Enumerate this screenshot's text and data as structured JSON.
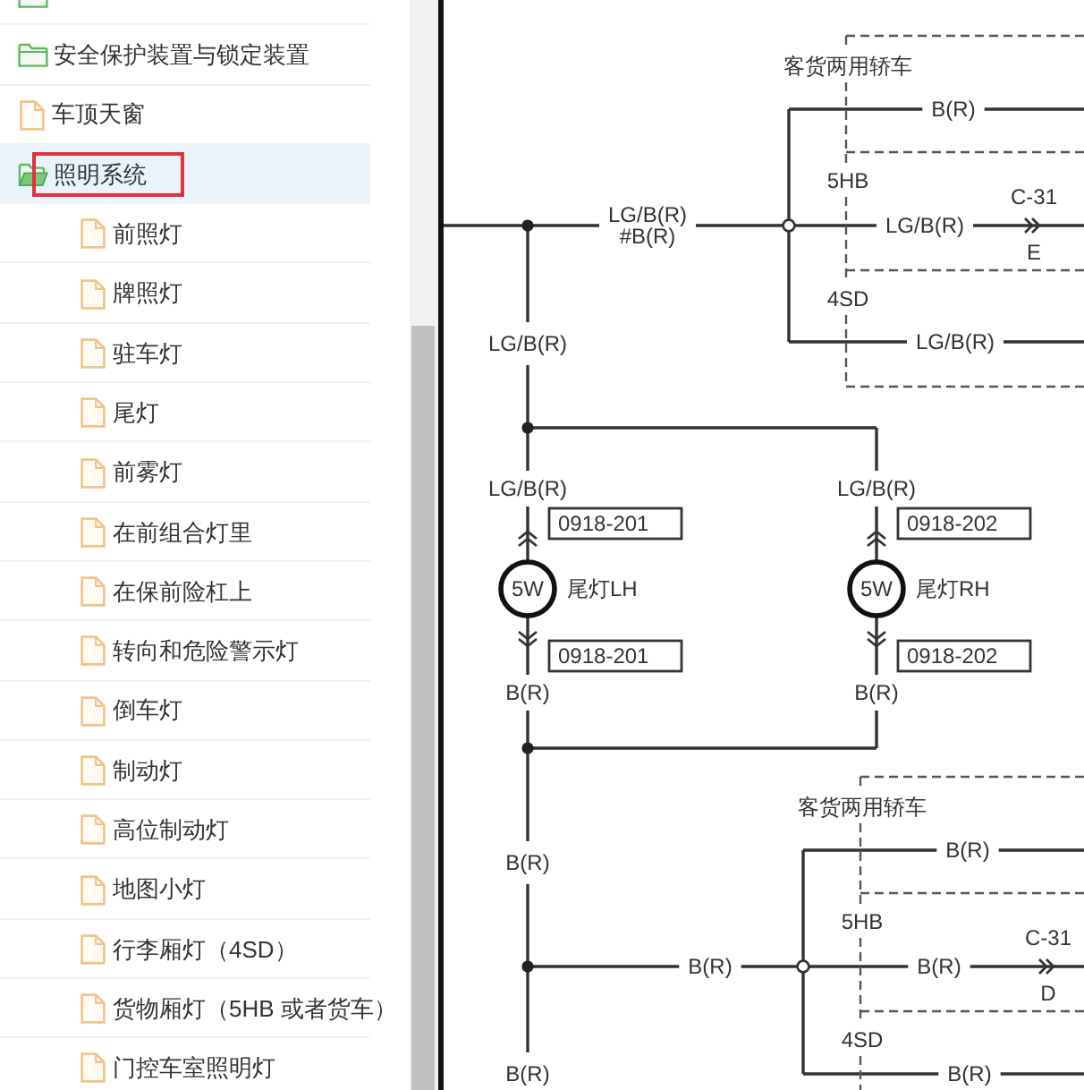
{
  "sidebar": {
    "items": [
      {
        "kind": "folder",
        "expanded": false,
        "selected": false,
        "highlighted": false
      },
      {
        "label": "安全保护装置与锁定装置",
        "kind": "folder",
        "expanded": false,
        "selected": false,
        "highlighted": false
      },
      {
        "label": "车顶天窗",
        "kind": "page",
        "selected": false,
        "highlighted": false
      },
      {
        "label": "照明系统",
        "kind": "folder",
        "expanded": true,
        "selected": true,
        "highlighted": true,
        "children": [
          {
            "label": "前照灯",
            "kind": "page",
            "selected": false,
            "highlighted": false
          },
          {
            "label": "牌照灯",
            "kind": "page",
            "selected": false,
            "highlighted": false
          },
          {
            "label": "驻车灯",
            "kind": "page",
            "selected": false,
            "highlighted": false
          },
          {
            "label": "尾灯",
            "kind": "page",
            "selected": false,
            "highlighted": false
          },
          {
            "label": "前雾灯",
            "kind": "page",
            "selected": false,
            "highlighted": false
          },
          {
            "label": "在前组合灯里",
            "kind": "page",
            "selected": false,
            "highlighted": false
          },
          {
            "label": "在保前险杠上",
            "kind": "page",
            "selected": false,
            "highlighted": false
          },
          {
            "label": "转向和危险警示灯",
            "kind": "page",
            "selected": false,
            "highlighted": false
          },
          {
            "label": "倒车灯",
            "kind": "page",
            "selected": false,
            "highlighted": false
          },
          {
            "label": "制动灯",
            "kind": "page",
            "selected": false,
            "highlighted": false
          },
          {
            "label": "高位制动灯",
            "kind": "page",
            "selected": false,
            "highlighted": false
          },
          {
            "label": "地图小灯",
            "kind": "page",
            "selected": false,
            "highlighted": false
          },
          {
            "label": "行李厢灯（4SD）",
            "kind": "page",
            "selected": false,
            "highlighted": false
          },
          {
            "label": "货物厢灯（5HB 或者货车）",
            "kind": "page",
            "selected": false,
            "highlighted": false
          },
          {
            "label": "门控车室照明灯",
            "kind": "page",
            "selected": false,
            "highlighted": false
          }
        ]
      }
    ]
  },
  "diagram": {
    "upper_circuit": {
      "feed_wire": "LG/B(R)",
      "feed_wire_alt": "#B(R)",
      "title": "客货两用轿车",
      "branches": [
        {
          "wire": "B(R)"
        },
        {
          "variant": "5HB",
          "wire": "LG/B(R)",
          "connector": "C-31",
          "pin": "E"
        },
        {
          "variant": "4SD",
          "wire": "LG/B(R)"
        }
      ]
    },
    "trunk_wire": "LG/B(R)",
    "lamps": [
      {
        "wire_in": "LG/B(R)",
        "connector_in": "0918-201",
        "rating": "5W",
        "name": "尾灯LH",
        "connector_out": "0918-201",
        "wire_out": "B(R)"
      },
      {
        "wire_in": "LG/B(R)",
        "connector_in": "0918-202",
        "rating": "5W",
        "name": "尾灯RH",
        "connector_out": "0918-202",
        "wire_out": "B(R)"
      }
    ],
    "ground_trunk_wires": [
      "B(R)",
      "B(R)"
    ],
    "lower_circuit": {
      "feed_wire": "B(R)",
      "title": "客货两用轿车",
      "branches": [
        {
          "wire": "B(R)"
        },
        {
          "variant": "5HB",
          "wire": "B(R)",
          "connector": "C-31",
          "pin": "D"
        },
        {
          "variant": "4SD",
          "wire": "B(R)"
        }
      ]
    }
  }
}
